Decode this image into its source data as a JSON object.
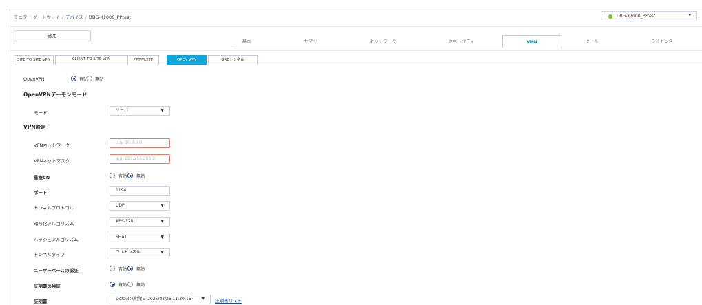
{
  "breadcrumb": {
    "items": [
      "モニタ",
      "ゲートウェイ",
      "デバイス"
    ],
    "current": "DBG-X1000_PPtest"
  },
  "device_selector": {
    "value": "DBG-X1000_PPtest",
    "status_color": "#7bbf2a"
  },
  "toolbar": {
    "apply_label": "適用"
  },
  "main_tabs": {
    "basic": "基本",
    "summary": "サマリ",
    "network": "ネットワーク",
    "security": "セキュリティ",
    "vpn": "VPN",
    "tools": "ツール",
    "license": "ライセンス"
  },
  "sub_tabs": {
    "site_to_site": "SITE TO SITE VPN",
    "client_to_site": "CLIENT TO SITE VPN",
    "pptp": "PPTP/L2TP",
    "openvpn": "OPEN VPN",
    "gre": "GREトンネル"
  },
  "openvpn": {
    "label": "OpenVPN",
    "enabled_label": "有効",
    "disabled_label": "無効",
    "value": "enabled"
  },
  "daemon": {
    "heading": "OpenVPNデーモンモード",
    "mode_label": "モード",
    "mode_value": "サーバ"
  },
  "vpn_settings": {
    "heading": "VPN設定",
    "network_label": "VPNネットワーク",
    "network_placeholder": "e.g. 10.7.0.0",
    "netmask_label": "VPNネットマスク",
    "netmask_placeholder": "e.g. 255.255.255.0",
    "dup_cn_label": "重複CN",
    "dup_cn_enabled": "有効",
    "dup_cn_disabled": "無効",
    "port_label": "ポート",
    "port_value": "1194",
    "protocol_label": "トンネルプロトコル",
    "protocol_value": "UDP",
    "cipher_label": "暗号化アルゴリズム",
    "cipher_value": "AES-128",
    "hash_label": "ハッシュアルゴリズム",
    "hash_value": "SHA1",
    "tunnel_type_label": "トンネルタイプ",
    "tunnel_type_value": "フルトンネル",
    "user_auth_label": "ユーザーベースの認証",
    "user_auth_enabled": "有効",
    "user_auth_disabled": "無効",
    "cert_verify_label": "証明書の検証",
    "cert_verify_enabled": "有効",
    "cert_verify_disabled": "無効",
    "cert_label": "証明書",
    "cert_value": "Default (期限日 2025/03/26 11:30:16)",
    "cert_list_link": "証明書リスト"
  },
  "colors": {
    "accent": "#10a6d8",
    "active_tab_text": "#0e90c4",
    "error_border": "#e27b6b"
  }
}
